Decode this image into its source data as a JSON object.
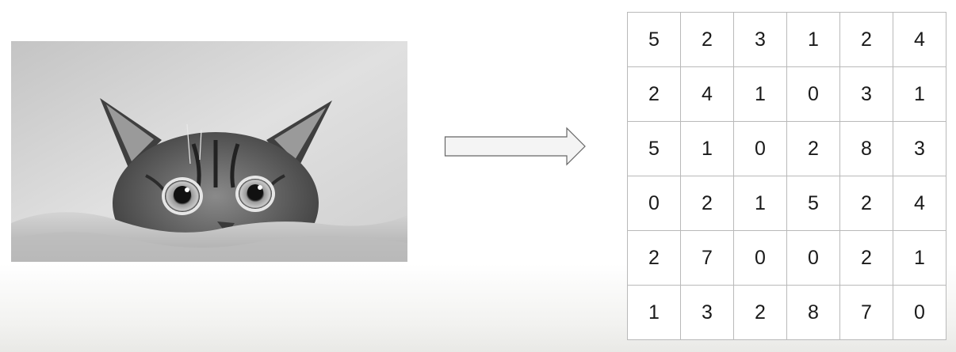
{
  "image": {
    "subject": "cat-photo",
    "style": "grayscale"
  },
  "arrow": {
    "icon": "right-arrow-icon"
  },
  "matrix": {
    "rows": [
      [
        "5",
        "2",
        "3",
        "1",
        "2",
        "4"
      ],
      [
        "2",
        "4",
        "1",
        "0",
        "3",
        "1"
      ],
      [
        "5",
        "1",
        "0",
        "2",
        "8",
        "3"
      ],
      [
        "0",
        "2",
        "1",
        "5",
        "2",
        "4"
      ],
      [
        "2",
        "7",
        "0",
        "0",
        "2",
        "1"
      ],
      [
        "1",
        "3",
        "2",
        "8",
        "7",
        "0"
      ]
    ]
  }
}
